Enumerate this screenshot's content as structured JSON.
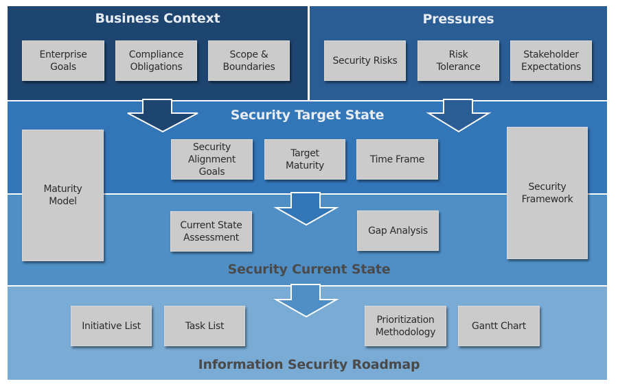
{
  "colors": {
    "business_context_bg": "#1e4570",
    "pressures_bg": "#2a5d93",
    "target_state_bg": "#3376b8",
    "current_state_bg": "#4f8fc6",
    "roadmap_bg": "#79abd5",
    "box_bg": "#cbcbcb",
    "divider": "#ffffff"
  },
  "business_context": {
    "title": "Business Context",
    "items": [
      "Enterprise\nGoals",
      "Compliance\nObligations",
      "Scope &\nBoundaries"
    ]
  },
  "pressures": {
    "title": "Pressures",
    "items": [
      "Security Risks",
      "Risk\nTolerance",
      "Stakeholder\nExpectations"
    ]
  },
  "target_state": {
    "title": "Security Target State",
    "items": [
      "Security\nAlignment\nGoals",
      "Target\nMaturity",
      "Time Frame"
    ]
  },
  "current_state": {
    "title": "Security Current State",
    "items": [
      "Current State\nAssessment",
      "Gap Analysis"
    ]
  },
  "side_boxes": {
    "left": "Maturity\nModel",
    "right": "Security\nFramework"
  },
  "roadmap": {
    "title": "Information Security Roadmap",
    "items": [
      "Initiative List",
      "Task List",
      "Prioritization\nMethodology",
      "Gantt Chart"
    ]
  }
}
